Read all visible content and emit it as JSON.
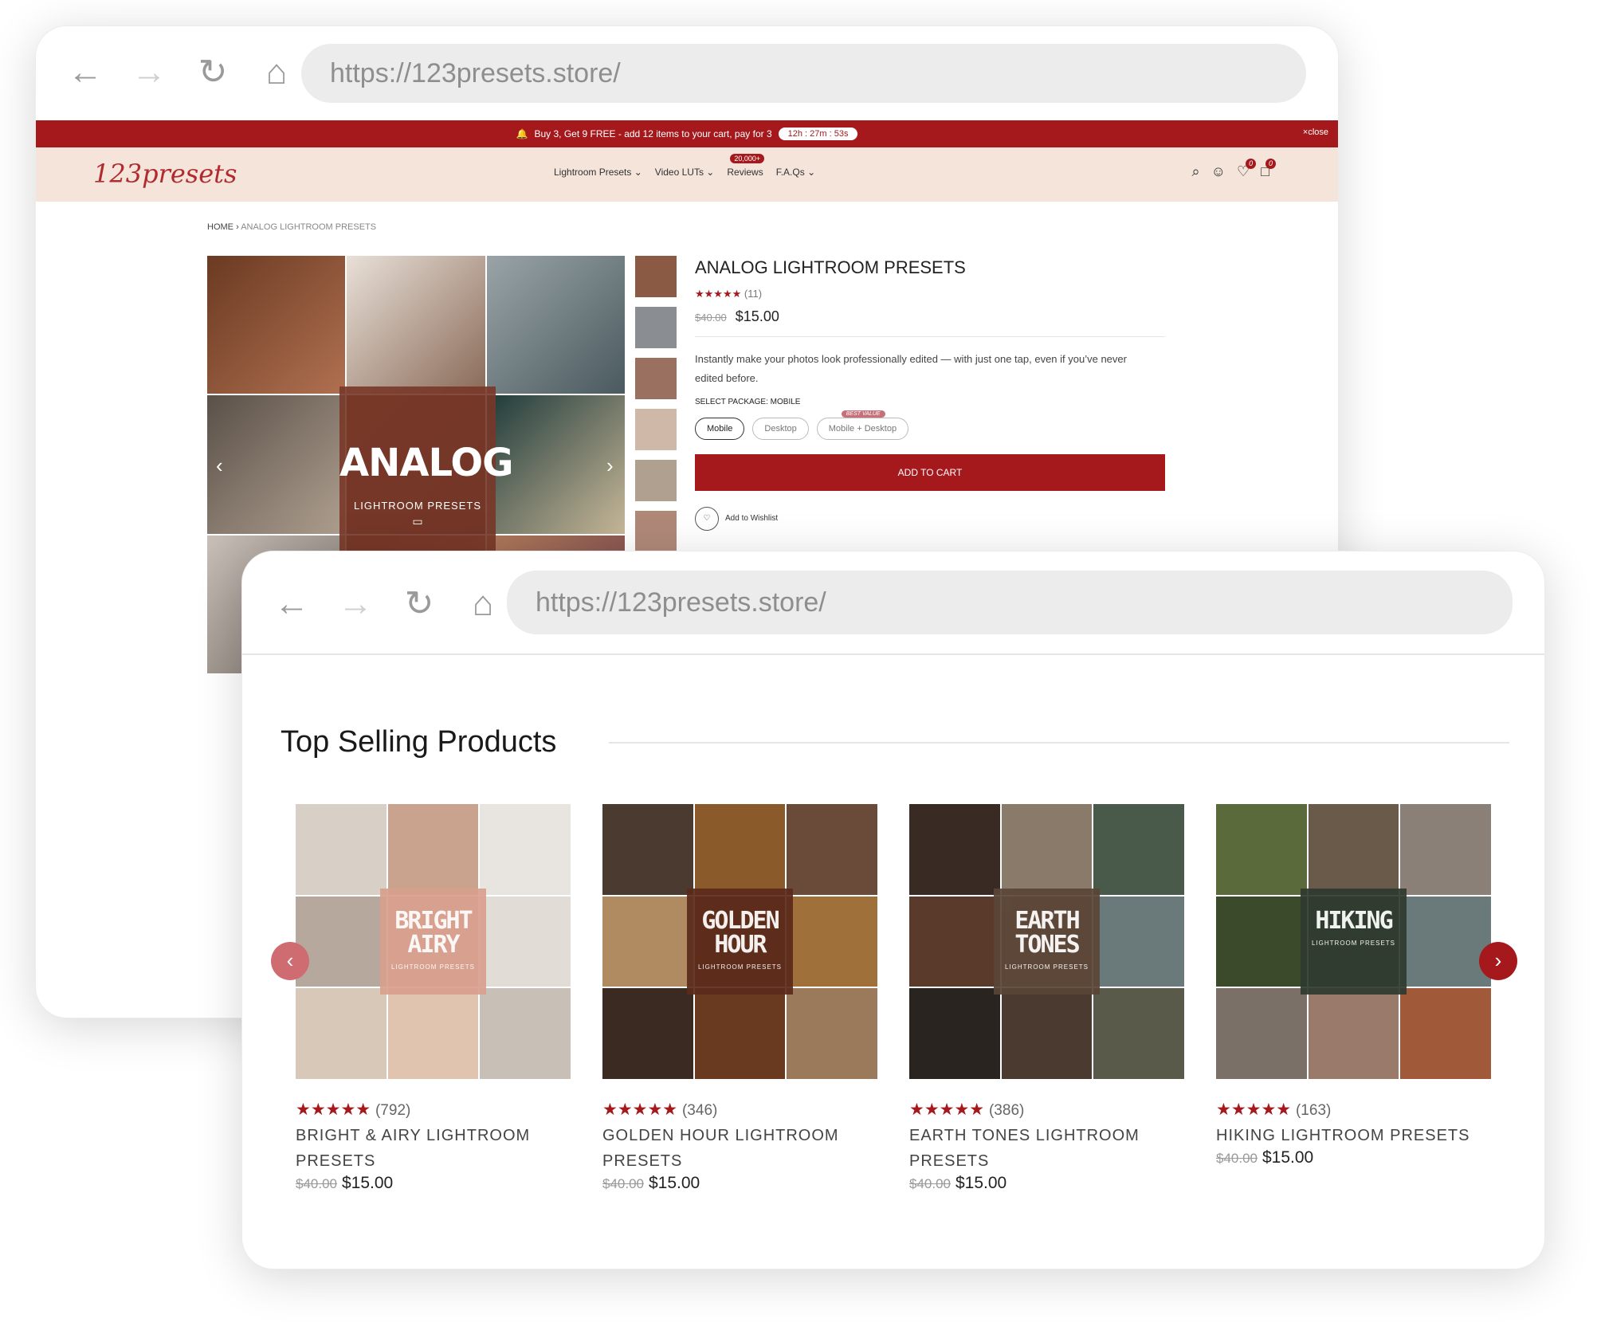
{
  "back_window": {
    "url": "https://123presets.store/",
    "announcement": "Buy 3, Get 9 FREE - add 12 items to your cart, pay for 3",
    "timer": "12h : 27m : 53s",
    "close_label": "close",
    "logo": "123presets",
    "nav": {
      "lightroom": "Lightroom Presets",
      "luts": "Video LUTs",
      "reviews_badge": "20,000+",
      "reviews": "Reviews",
      "faqs": "F.A.Qs"
    },
    "wishlist_count": "0",
    "cart_count": "0",
    "breadcrumb": {
      "home": "HOME",
      "current": "ANALOG LIGHTROOM PRESETS"
    },
    "gallery_overlay": {
      "title": "ANALOG",
      "subtitle": "LIGHTROOM PRESETS"
    },
    "product": {
      "title": "ANALOG LIGHTROOM PRESETS",
      "review_count": "(11)",
      "old_price": "$40.00",
      "price": "$15.00",
      "description": "Instantly make your photos look professionally edited — with just one tap, even if you’ve never edited before.",
      "package_label": "SELECT PACKAGE: MOBILE",
      "packages": [
        "Mobile",
        "Desktop",
        "Mobile + Desktop"
      ],
      "best_value": "BEST VALUE",
      "add_to_cart": "ADD TO CART",
      "wishlist": "Add to Wishlist"
    }
  },
  "front_window": {
    "url": "https://123presets.store/",
    "section_title": "Top Selling Products",
    "products": [
      {
        "overlay": "BRIGHT AIRY",
        "overlay_sub": "LIGHTROOM PRESETS",
        "reviews": "(792)",
        "name": "BRIGHT & AIRY LIGHTROOM PRESETS",
        "old_price": "$40.00",
        "price": "$15.00",
        "overlay_color": "#d9a08e"
      },
      {
        "overlay": "GOLDEN HOUR",
        "overlay_sub": "LIGHTROOM PRESETS",
        "reviews": "(346)",
        "name": "GOLDEN HOUR LIGHTROOM PRESETS",
        "old_price": "$40.00",
        "price": "$15.00",
        "overlay_color": "#5b2a1a"
      },
      {
        "overlay": "EARTH TONES",
        "overlay_sub": "LIGHTROOM PRESETS",
        "reviews": "(386)",
        "name": "EARTH TONES LIGHTROOM PRESETS",
        "old_price": "$40.00",
        "price": "$15.00",
        "overlay_color": "#5a4536"
      },
      {
        "overlay": "HIKING",
        "overlay_sub": "LIGHTROOM PRESETS",
        "reviews": "(163)",
        "name": "HIKING LIGHTROOM PRESETS",
        "old_price": "$40.00",
        "price": "$15.00",
        "overlay_color": "#2f3a30"
      }
    ]
  },
  "colors": {
    "brand_red": "#a5191d",
    "header_bg": "#f4e4da"
  }
}
